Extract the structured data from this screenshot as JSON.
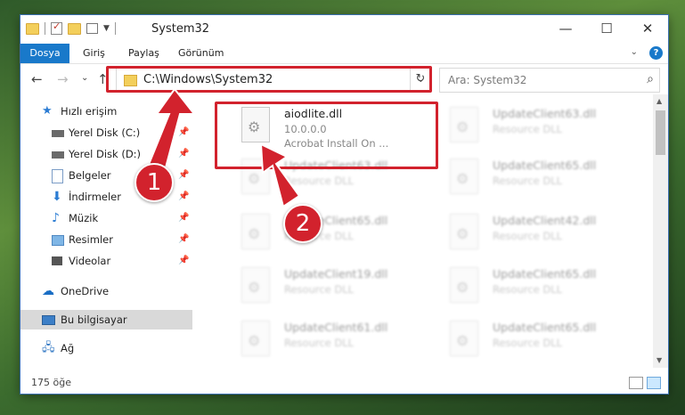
{
  "window": {
    "title": "System32",
    "minimize": "—",
    "maximize": "☐",
    "close": "✕"
  },
  "ribbon": {
    "tabs": [
      "Dosya",
      "Giriş",
      "Paylaş",
      "Görünüm"
    ]
  },
  "address": {
    "path": "C:\\Windows\\System32",
    "search_placeholder": "Ara: System32"
  },
  "nav": {
    "quick_access": "Hızlı erişim",
    "items": [
      {
        "label": "Yerel Disk (C:)",
        "icon": "drive-icon",
        "pinned": true
      },
      {
        "label": "Yerel Disk (D:)",
        "icon": "drive-icon",
        "pinned": true
      },
      {
        "label": "Belgeler",
        "icon": "documents-icon",
        "pinned": true
      },
      {
        "label": "İndirmeler",
        "icon": "download-icon",
        "pinned": true
      },
      {
        "label": "Müzik",
        "icon": "music-icon",
        "pinned": true
      },
      {
        "label": "Resimler",
        "icon": "pictures-icon",
        "pinned": true
      },
      {
        "label": "Videolar",
        "icon": "videos-icon",
        "pinned": true
      }
    ],
    "onedrive": "OneDrive",
    "this_pc": "Bu bilgisayar",
    "network": "Ağ"
  },
  "files": {
    "highlighted": {
      "name": "aiodlite.dll",
      "version": "10.0.0.0",
      "desc": "Acrobat Install On ..."
    },
    "blurred": [
      {
        "name": "UpdateClient63.dll",
        "desc": "Resource DLL"
      },
      {
        "name": "UpdateClient63.dll",
        "desc": "Resource DLL"
      },
      {
        "name": "UpdateClient65.dll",
        "desc": "Resource DLL"
      },
      {
        "name": "UpdateClient65.dll",
        "desc": "Resource DLL"
      },
      {
        "name": "UpdateClient42.dll",
        "desc": "Resource DLL"
      },
      {
        "name": "UpdateClient19.dll",
        "desc": "Resource DLL"
      },
      {
        "name": "UpdateClient65.dll",
        "desc": "Resource DLL"
      },
      {
        "name": "UpdateClient61.dll",
        "desc": "Resource DLL"
      },
      {
        "name": "UpdateClient65.dll",
        "desc": "Resource DLL"
      }
    ]
  },
  "status": {
    "count": "175 öğe"
  },
  "annotations": {
    "step1": "1",
    "step2": "2"
  },
  "colors": {
    "accent": "#1979ca",
    "highlight": "#d2222d"
  }
}
